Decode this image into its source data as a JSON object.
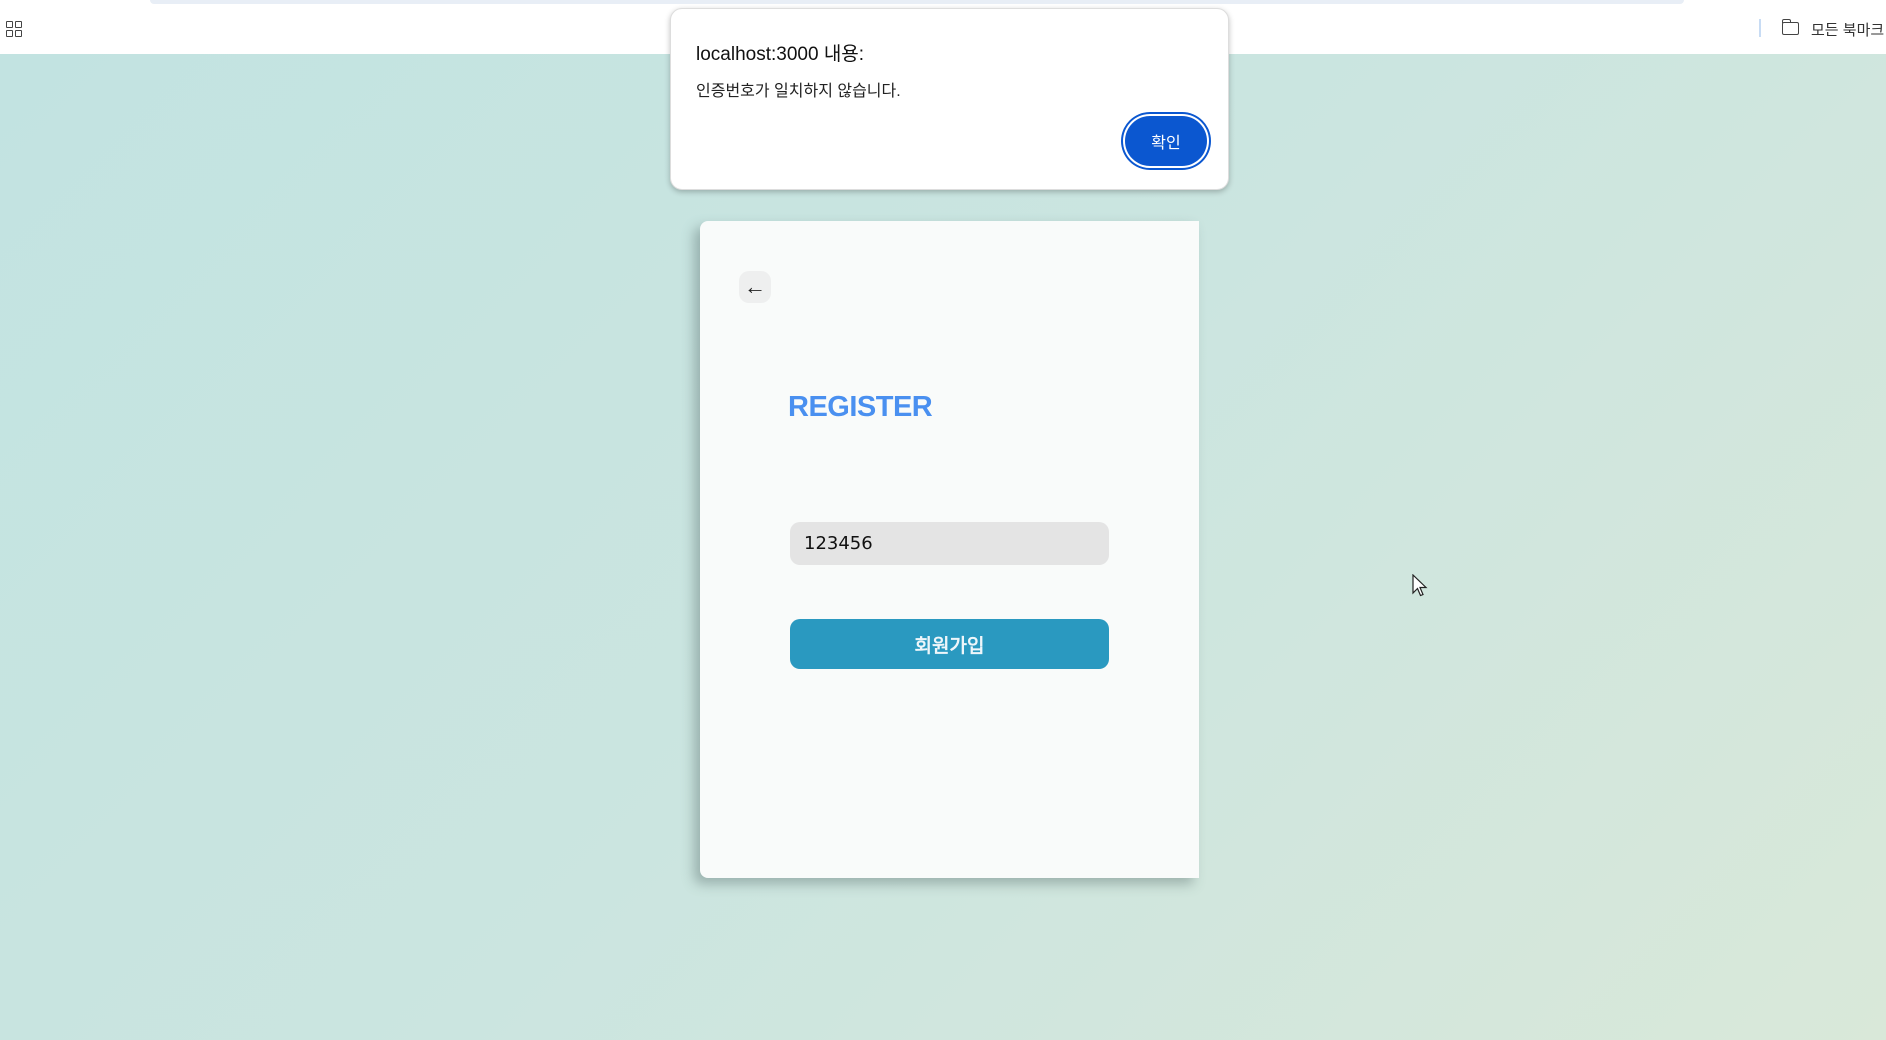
{
  "browser": {
    "apps_icon": "grid-icon",
    "bookmarks": {
      "icon": "folder-icon",
      "label": "모든 북마크"
    }
  },
  "dialog": {
    "title": "localhost:3000 내용:",
    "message": "인증번호가 일치하지 않습니다.",
    "ok_label": "확인",
    "ok_color": "#0b57d0"
  },
  "card": {
    "back_icon": "arrow-left-icon",
    "back_glyph": "←",
    "title": "REGISTER",
    "title_color": "#4a90f0",
    "code_input": {
      "value": "123456"
    },
    "submit_label": "회원가입",
    "submit_color": "#2a99c0"
  }
}
